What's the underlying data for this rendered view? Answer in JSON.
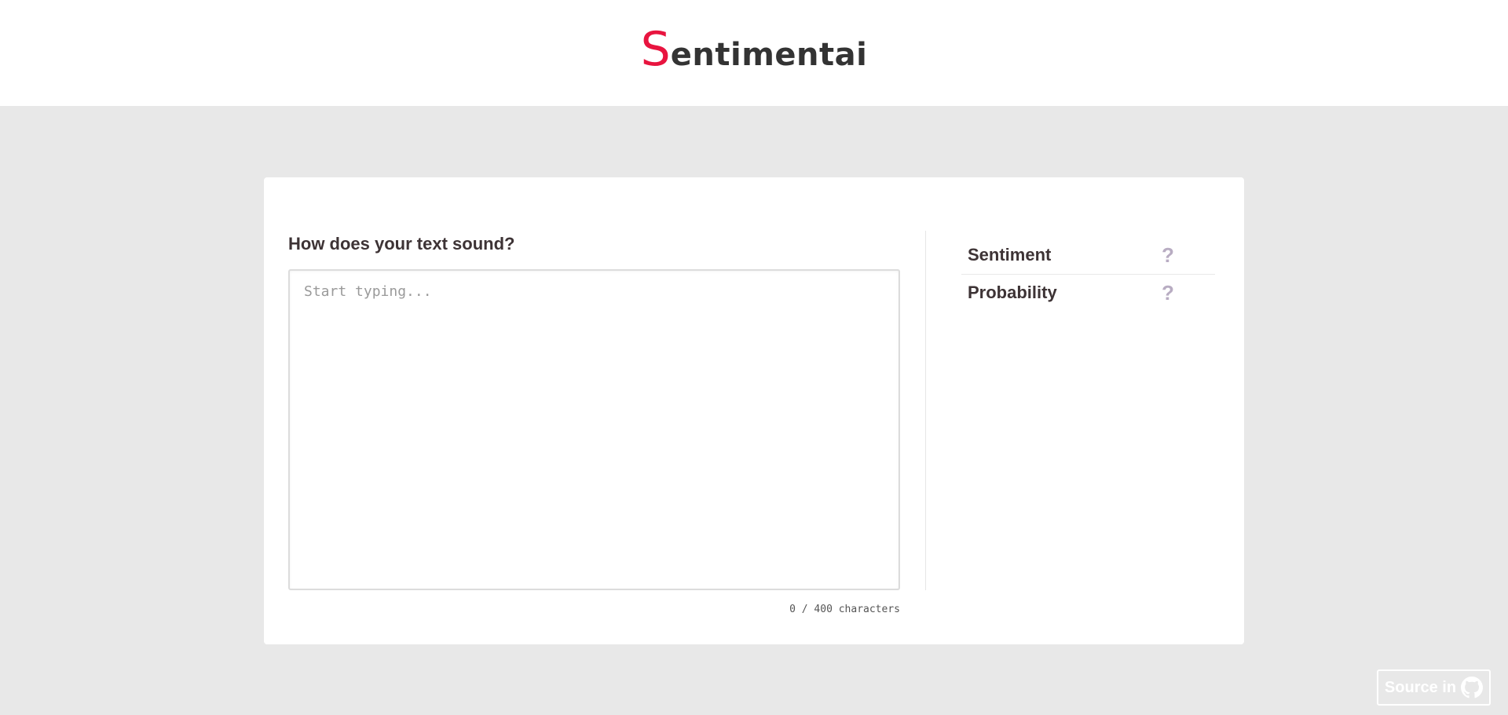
{
  "header": {
    "logo_first_letter": "S",
    "logo_rest": "entimentai",
    "accent_color": "#e8143f"
  },
  "main": {
    "question": "How does your text sound?",
    "input": {
      "value": "",
      "placeholder": "Start typing..."
    },
    "counter": "0 / 400 characters"
  },
  "results": [
    {
      "label": "Sentiment",
      "value": "?"
    },
    {
      "label": "Probability",
      "value": "?"
    }
  ],
  "footer": {
    "source_label": "Source in",
    "icon": "github-icon"
  }
}
